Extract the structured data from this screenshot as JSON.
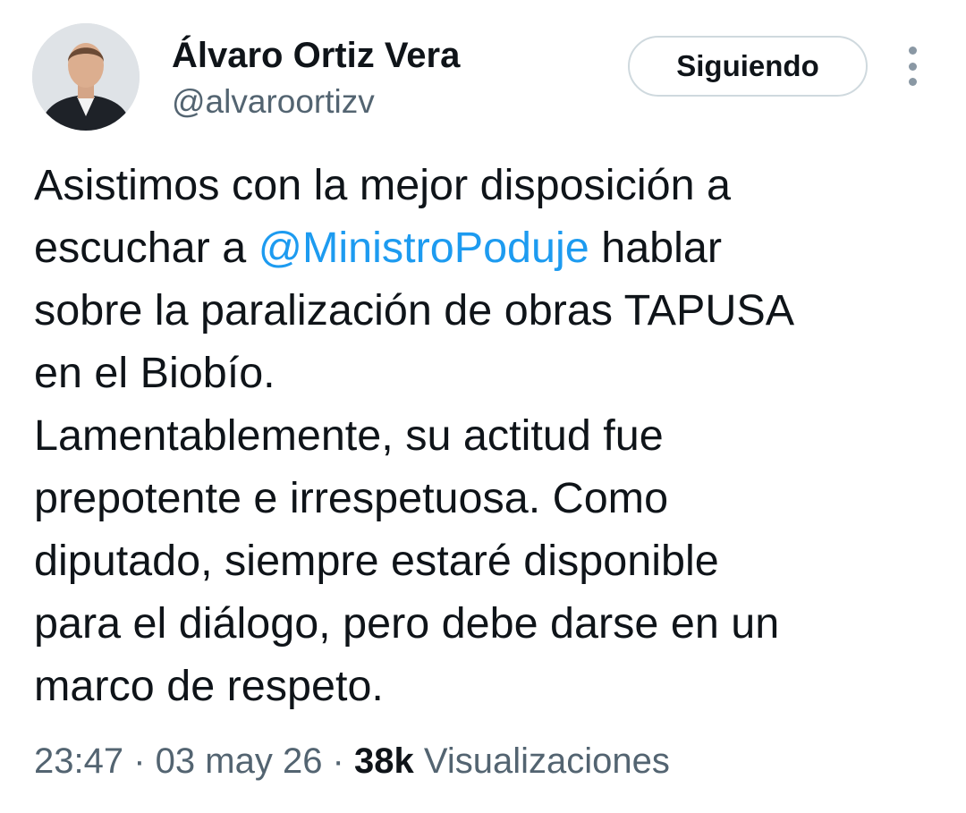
{
  "author": {
    "display_name": "Álvaro Ortiz Vera",
    "handle": "@alvaroortizv"
  },
  "follow_button": {
    "label": "Siguiendo"
  },
  "menu": {
    "icon": "more-options-vertical-icon"
  },
  "tweet": {
    "lines": [
      {
        "before": "Asistimos con la mejor disposición a"
      },
      {
        "before": "escuchar a ",
        "mention": "@MinistroPoduje",
        "after": " hablar"
      },
      {
        "before": "sobre la paralización de obras TAPUSA"
      },
      {
        "before": "en el Biobío."
      },
      {
        "before": "Lamentablemente, su actitud fue"
      },
      {
        "before": "prepotente e irrespetuosa. Como"
      },
      {
        "before": "diputado, siempre estaré disponible"
      },
      {
        "before": "para el diálogo, pero debe darse en un"
      },
      {
        "before": "marco de respeto."
      }
    ]
  },
  "meta": {
    "time": "23:47",
    "separator": " · ",
    "date": "03 may 26",
    "views_count": "38k",
    "views_label": "Visualizaciones"
  },
  "colors": {
    "text": "#0f1419",
    "secondary": "#536471",
    "link": "#1d9bf0",
    "button_border": "#cfd9de"
  }
}
